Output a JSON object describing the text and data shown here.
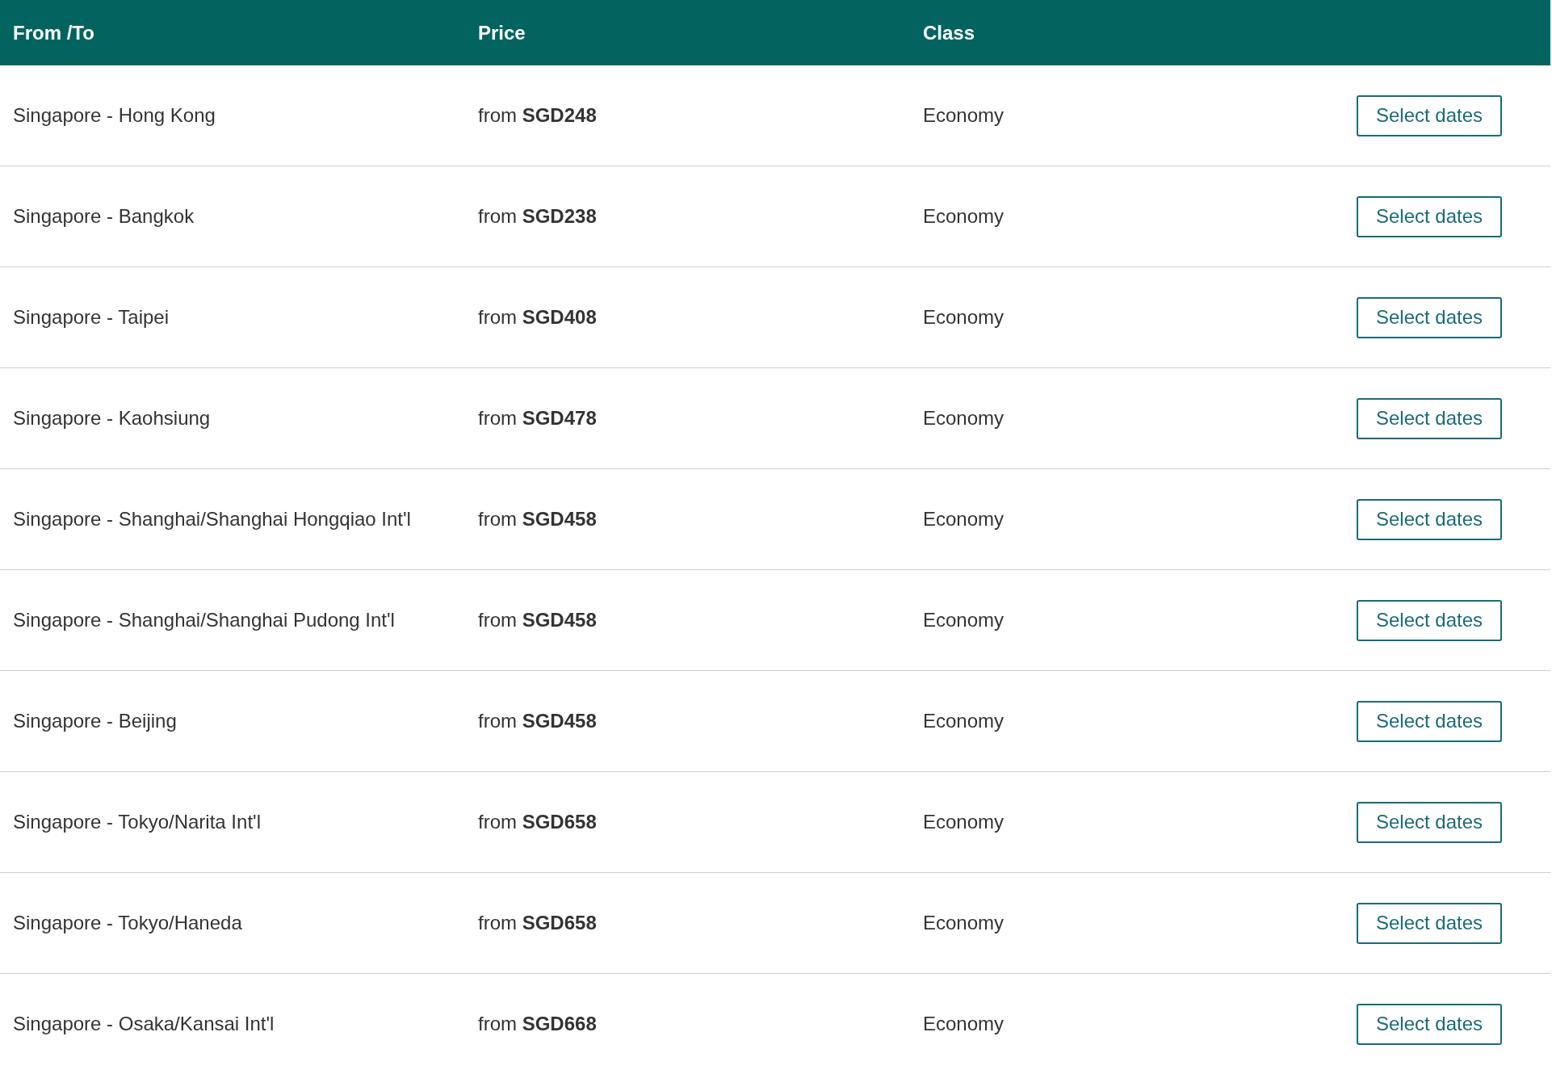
{
  "table": {
    "columns": [
      "From /To",
      "Price",
      "Class"
    ],
    "rows": [
      {
        "route": "Singapore - Hong Kong",
        "price": "from **SGD248**",
        "class": "Economy",
        "action": "Select dates"
      },
      {
        "route": "Singapore - Bangkok",
        "price": "from **SGD238**",
        "class": "Economy",
        "action": "Select dates"
      },
      {
        "route": "Singapore - Taipei",
        "price": "from **SGD408**",
        "class": "Economy",
        "action": "Select dates"
      },
      {
        "route": "Singapore - Kaohsiung",
        "price": "from **SGD478**",
        "class": "Economy",
        "action": "Select dates"
      },
      {
        "route": "Singapore - Shanghai/Shanghai Hongqiao Int'l",
        "price": "from **SGD458**",
        "class": "Economy",
        "action": "Select dates"
      },
      {
        "route": "Singapore - Shanghai/Shanghai Pudong Int'l",
        "price": "from **SGD458**",
        "class": "Economy",
        "action": "Select dates"
      },
      {
        "route": "Singapore - Beijing",
        "price": "from **SGD458**",
        "class": "Economy",
        "action": "Select dates"
      },
      {
        "route": "Singapore - Tokyo/Narita Int'l",
        "price": "from **SGD658**",
        "class": "Economy",
        "action": "Select dates"
      },
      {
        "route": "Singapore - Tokyo/Haneda",
        "price": "from **SGD658**",
        "class": "Economy",
        "action": "Select dates"
      },
      {
        "route": "Singapore - Osaka/Kansai Int'l",
        "price": "from **SGD668**",
        "class": "Economy",
        "action": "Select dates"
      }
    ]
  }
}
